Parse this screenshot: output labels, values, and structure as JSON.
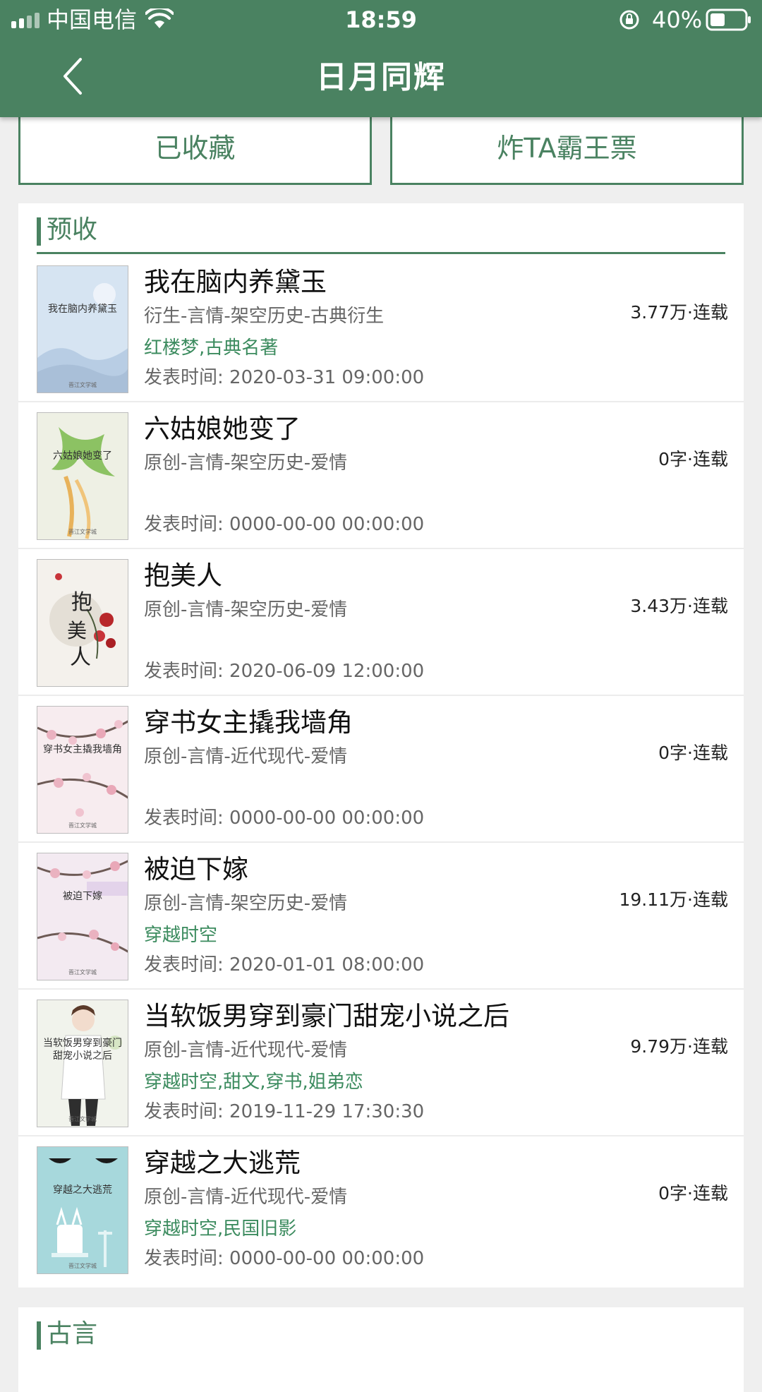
{
  "status_bar": {
    "carrier": "中国电信",
    "time": "18:59",
    "battery": "40%"
  },
  "header": {
    "title": "日月同辉",
    "back_icon": "chevron-left-icon"
  },
  "actions": {
    "favorite_label": "已收藏",
    "ticket_label": "炸TA霸王票"
  },
  "colors": {
    "accent": "#4a8261",
    "tag_green": "#3b8b5e"
  },
  "sections": [
    {
      "title": "预收",
      "books": [
        {
          "title": "我在脑内养黛玉",
          "genre": "衍生-言情-架空历史-古典衍生",
          "tags": "红楼梦,古典名著",
          "date": "发表时间: 2020-03-31 09:00:00",
          "stat": "3.77万·连载",
          "cover_text": "我在脑内养黛玉",
          "cover_pub": "晋江文学城"
        },
        {
          "title": "六姑娘她变了",
          "genre": "原创-言情-架空历史-爱情",
          "tags": "",
          "date": "发表时间: 0000-00-00 00:00:00",
          "stat": "0字·连载",
          "cover_text": "六姑娘她变了",
          "cover_pub": "晋江文学城"
        },
        {
          "title": "抱美人",
          "genre": "原创-言情-架空历史-爱情",
          "tags": "",
          "date": "发表时间: 2020-06-09 12:00:00",
          "stat": "3.43万·连载",
          "cover_text": "抱美人",
          "cover_pub": ""
        },
        {
          "title": "穿书女主撬我墙角",
          "genre": "原创-言情-近代现代-爱情",
          "tags": "",
          "date": "发表时间: 0000-00-00 00:00:00",
          "stat": "0字·连载",
          "cover_text": "穿书女主撬我墙角",
          "cover_pub": "晋江文学城"
        },
        {
          "title": "被迫下嫁",
          "genre": "原创-言情-架空历史-爱情",
          "tags": "穿越时空",
          "date": "发表时间: 2020-01-01 08:00:00",
          "stat": "19.11万·连载",
          "cover_text": "被迫下嫁",
          "cover_pub": "晋江文学城"
        },
        {
          "title": "当软饭男穿到豪门甜宠小说之后",
          "genre": "原创-言情-近代现代-爱情",
          "tags": "穿越时空,甜文,穿书,姐弟恋",
          "date": "发表时间: 2019-11-29 17:30:30",
          "stat": "9.79万·连载",
          "cover_text": "当软饭男穿到豪门甜宠小说之后",
          "cover_pub": "晋江文学城"
        },
        {
          "title": "穿越之大逃荒",
          "genre": "原创-言情-近代现代-爱情",
          "tags": "穿越时空,民国旧影",
          "date": "发表时间: 0000-00-00 00:00:00",
          "stat": "0字·连载",
          "cover_text": "穿越之大逃荒",
          "cover_pub": "晋江文学城"
        }
      ]
    },
    {
      "title": "古言",
      "books": []
    }
  ]
}
